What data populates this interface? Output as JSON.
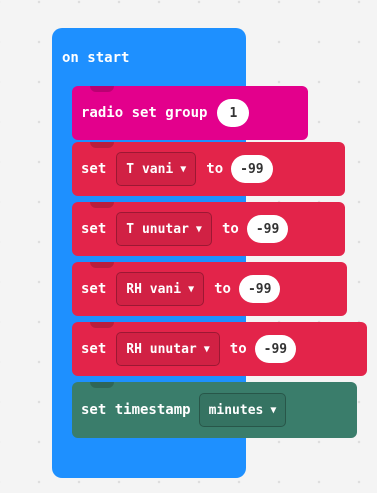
{
  "on_start": {
    "label": "on start"
  },
  "radio": {
    "label": "radio set group",
    "value": "1"
  },
  "sets": [
    {
      "kw": "set",
      "var": "T vani",
      "to": "to",
      "value": "-99"
    },
    {
      "kw": "set",
      "var": "T unutar",
      "to": "to",
      "value": "-99"
    },
    {
      "kw": "set",
      "var": "RH vani",
      "to": "to",
      "value": "-99"
    },
    {
      "kw": "set",
      "var": "RH unutar",
      "to": "to",
      "value": "-99"
    }
  ],
  "timestamp": {
    "label": "set timestamp",
    "unit": "minutes"
  },
  "icons": {
    "dropdown": "caret-down-icon"
  },
  "colors": {
    "event": "#1e90ff",
    "radio": "#e3008c",
    "variables": "#e3244a",
    "timestamp": "#3a7d6b"
  }
}
